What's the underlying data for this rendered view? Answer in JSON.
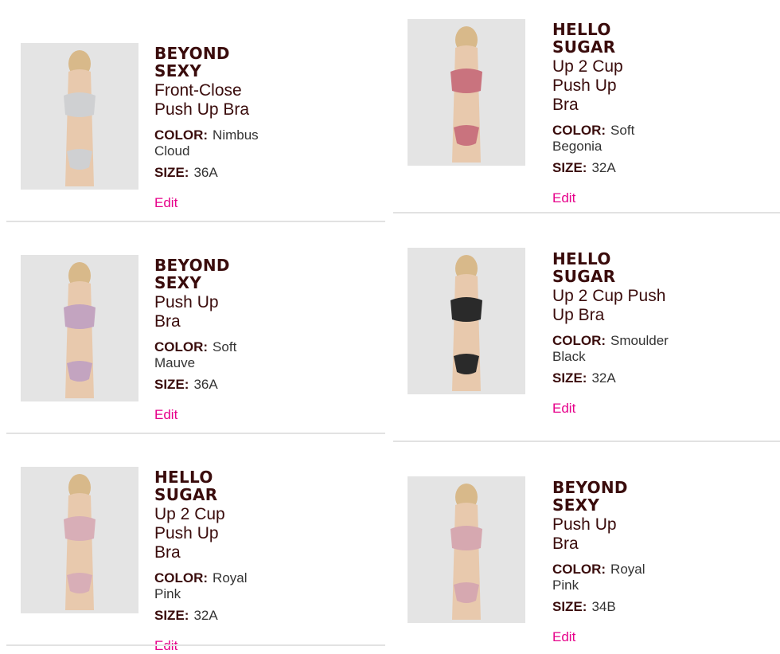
{
  "items": [
    {
      "brand": "BEYOND SEXY",
      "name": "Front-Close Push Up Bra",
      "color_label": "COLOR:",
      "color": "Nimbus Cloud",
      "size_label": "SIZE:",
      "size": "36A",
      "edit": "Edit",
      "swatch": "#cfd0d2"
    },
    {
      "brand": "HELLO SUGAR",
      "name": "Up 2 Cup Push Up Bra",
      "color_label": "COLOR:",
      "color": "Soft Begonia",
      "size_label": "SIZE:",
      "size": "32A",
      "edit": "Edit",
      "swatch": "#c9737e"
    },
    {
      "brand": "BEYOND SEXY",
      "name": "Push Up Bra",
      "color_label": "COLOR:",
      "color": "Soft Mauve",
      "size_label": "SIZE:",
      "size": "36A",
      "edit": "Edit",
      "swatch": "#c3a4c0"
    },
    {
      "brand": "HELLO SUGAR",
      "name": "Up 2 Cup Push Up Bra",
      "color_label": "COLOR:",
      "color": "Smoulder Black",
      "size_label": "SIZE:",
      "size": "32A",
      "edit": "Edit",
      "swatch": "#2a2a2a"
    },
    {
      "brand": "HELLO SUGAR",
      "name": "Up 2 Cup Push Up Bra",
      "color_label": "COLOR:",
      "color": "Royal Pink",
      "size_label": "SIZE:",
      "size": "32A",
      "edit": "Edit",
      "swatch": "#d8aeb7"
    },
    {
      "brand": "BEYOND SEXY",
      "name": "Push Up Bra",
      "color_label": "COLOR:",
      "color": "Royal Pink",
      "size_label": "SIZE:",
      "size": "34B",
      "edit": "Edit",
      "swatch": "#d6a8b0"
    }
  ],
  "colors": {
    "brand_text": "#3a0c0c",
    "edit_link": "#e6008a",
    "divider": "#e2e2e2",
    "thumb_bg": "#e4e4e4"
  }
}
